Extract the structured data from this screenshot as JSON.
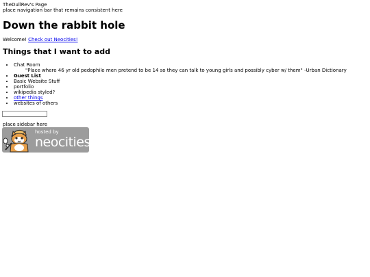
{
  "header": {
    "site_title": "TheDullRev's Page",
    "nav_placeholder": "place navigation bar that remains consistent here"
  },
  "main": {
    "heading": "Down the rabbit hole",
    "welcome_text": "Welcome!",
    "neocities_link": "Check out Neocities!",
    "list_heading": "Things that I want to add",
    "items": [
      {
        "label": "Chat Room",
        "quote": "\"Place where 46 yr old pedophile men pretend to be 14 so they can talk to young girls and possibly cyber w/ them\" -Urban Dictionary"
      },
      {
        "label": "Guest List"
      },
      {
        "label": "Basic Website Stuff"
      },
      {
        "label": "portfolio"
      },
      {
        "label": "wikipedia styled?"
      },
      {
        "label": "other things"
      },
      {
        "label": "websites of others"
      }
    ]
  },
  "search": {
    "value": ""
  },
  "sidebar": {
    "placeholder": "place sidebar here"
  },
  "badge": {
    "small_text": "hosted by",
    "big_text": "neocities",
    "colors": {
      "background": "#9c9c9c",
      "cat_body": "#e8a04a",
      "hat": "#f2c36b",
      "text": "#ffffff"
    }
  }
}
